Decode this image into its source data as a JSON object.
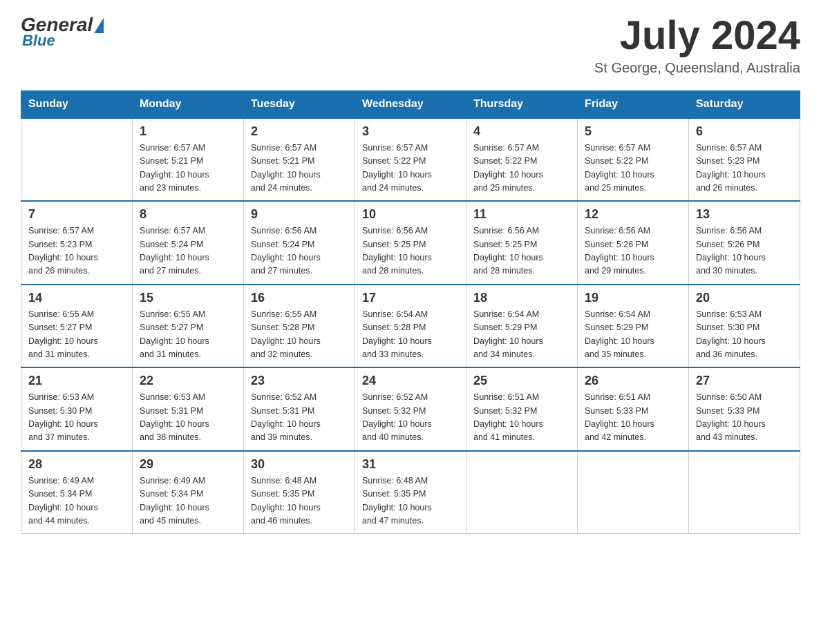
{
  "header": {
    "logo": {
      "general": "General",
      "blue": "Blue",
      "arrow": "▲"
    },
    "title": "July 2024",
    "location": "St George, Queensland, Australia"
  },
  "weekdays": [
    "Sunday",
    "Monday",
    "Tuesday",
    "Wednesday",
    "Thursday",
    "Friday",
    "Saturday"
  ],
  "weeks": [
    [
      {
        "day": "",
        "info": ""
      },
      {
        "day": "1",
        "info": "Sunrise: 6:57 AM\nSunset: 5:21 PM\nDaylight: 10 hours\nand 23 minutes."
      },
      {
        "day": "2",
        "info": "Sunrise: 6:57 AM\nSunset: 5:21 PM\nDaylight: 10 hours\nand 24 minutes."
      },
      {
        "day": "3",
        "info": "Sunrise: 6:57 AM\nSunset: 5:22 PM\nDaylight: 10 hours\nand 24 minutes."
      },
      {
        "day": "4",
        "info": "Sunrise: 6:57 AM\nSunset: 5:22 PM\nDaylight: 10 hours\nand 25 minutes."
      },
      {
        "day": "5",
        "info": "Sunrise: 6:57 AM\nSunset: 5:22 PM\nDaylight: 10 hours\nand 25 minutes."
      },
      {
        "day": "6",
        "info": "Sunrise: 6:57 AM\nSunset: 5:23 PM\nDaylight: 10 hours\nand 26 minutes."
      }
    ],
    [
      {
        "day": "7",
        "info": "Sunrise: 6:57 AM\nSunset: 5:23 PM\nDaylight: 10 hours\nand 26 minutes."
      },
      {
        "day": "8",
        "info": "Sunrise: 6:57 AM\nSunset: 5:24 PM\nDaylight: 10 hours\nand 27 minutes."
      },
      {
        "day": "9",
        "info": "Sunrise: 6:56 AM\nSunset: 5:24 PM\nDaylight: 10 hours\nand 27 minutes."
      },
      {
        "day": "10",
        "info": "Sunrise: 6:56 AM\nSunset: 5:25 PM\nDaylight: 10 hours\nand 28 minutes."
      },
      {
        "day": "11",
        "info": "Sunrise: 6:56 AM\nSunset: 5:25 PM\nDaylight: 10 hours\nand 28 minutes."
      },
      {
        "day": "12",
        "info": "Sunrise: 6:56 AM\nSunset: 5:26 PM\nDaylight: 10 hours\nand 29 minutes."
      },
      {
        "day": "13",
        "info": "Sunrise: 6:56 AM\nSunset: 5:26 PM\nDaylight: 10 hours\nand 30 minutes."
      }
    ],
    [
      {
        "day": "14",
        "info": "Sunrise: 6:55 AM\nSunset: 5:27 PM\nDaylight: 10 hours\nand 31 minutes."
      },
      {
        "day": "15",
        "info": "Sunrise: 6:55 AM\nSunset: 5:27 PM\nDaylight: 10 hours\nand 31 minutes."
      },
      {
        "day": "16",
        "info": "Sunrise: 6:55 AM\nSunset: 5:28 PM\nDaylight: 10 hours\nand 32 minutes."
      },
      {
        "day": "17",
        "info": "Sunrise: 6:54 AM\nSunset: 5:28 PM\nDaylight: 10 hours\nand 33 minutes."
      },
      {
        "day": "18",
        "info": "Sunrise: 6:54 AM\nSunset: 5:29 PM\nDaylight: 10 hours\nand 34 minutes."
      },
      {
        "day": "19",
        "info": "Sunrise: 6:54 AM\nSunset: 5:29 PM\nDaylight: 10 hours\nand 35 minutes."
      },
      {
        "day": "20",
        "info": "Sunrise: 6:53 AM\nSunset: 5:30 PM\nDaylight: 10 hours\nand 36 minutes."
      }
    ],
    [
      {
        "day": "21",
        "info": "Sunrise: 6:53 AM\nSunset: 5:30 PM\nDaylight: 10 hours\nand 37 minutes."
      },
      {
        "day": "22",
        "info": "Sunrise: 6:53 AM\nSunset: 5:31 PM\nDaylight: 10 hours\nand 38 minutes."
      },
      {
        "day": "23",
        "info": "Sunrise: 6:52 AM\nSunset: 5:31 PM\nDaylight: 10 hours\nand 39 minutes."
      },
      {
        "day": "24",
        "info": "Sunrise: 6:52 AM\nSunset: 5:32 PM\nDaylight: 10 hours\nand 40 minutes."
      },
      {
        "day": "25",
        "info": "Sunrise: 6:51 AM\nSunset: 5:32 PM\nDaylight: 10 hours\nand 41 minutes."
      },
      {
        "day": "26",
        "info": "Sunrise: 6:51 AM\nSunset: 5:33 PM\nDaylight: 10 hours\nand 42 minutes."
      },
      {
        "day": "27",
        "info": "Sunrise: 6:50 AM\nSunset: 5:33 PM\nDaylight: 10 hours\nand 43 minutes."
      }
    ],
    [
      {
        "day": "28",
        "info": "Sunrise: 6:49 AM\nSunset: 5:34 PM\nDaylight: 10 hours\nand 44 minutes."
      },
      {
        "day": "29",
        "info": "Sunrise: 6:49 AM\nSunset: 5:34 PM\nDaylight: 10 hours\nand 45 minutes."
      },
      {
        "day": "30",
        "info": "Sunrise: 6:48 AM\nSunset: 5:35 PM\nDaylight: 10 hours\nand 46 minutes."
      },
      {
        "day": "31",
        "info": "Sunrise: 6:48 AM\nSunset: 5:35 PM\nDaylight: 10 hours\nand 47 minutes."
      },
      {
        "day": "",
        "info": ""
      },
      {
        "day": "",
        "info": ""
      },
      {
        "day": "",
        "info": ""
      }
    ]
  ]
}
